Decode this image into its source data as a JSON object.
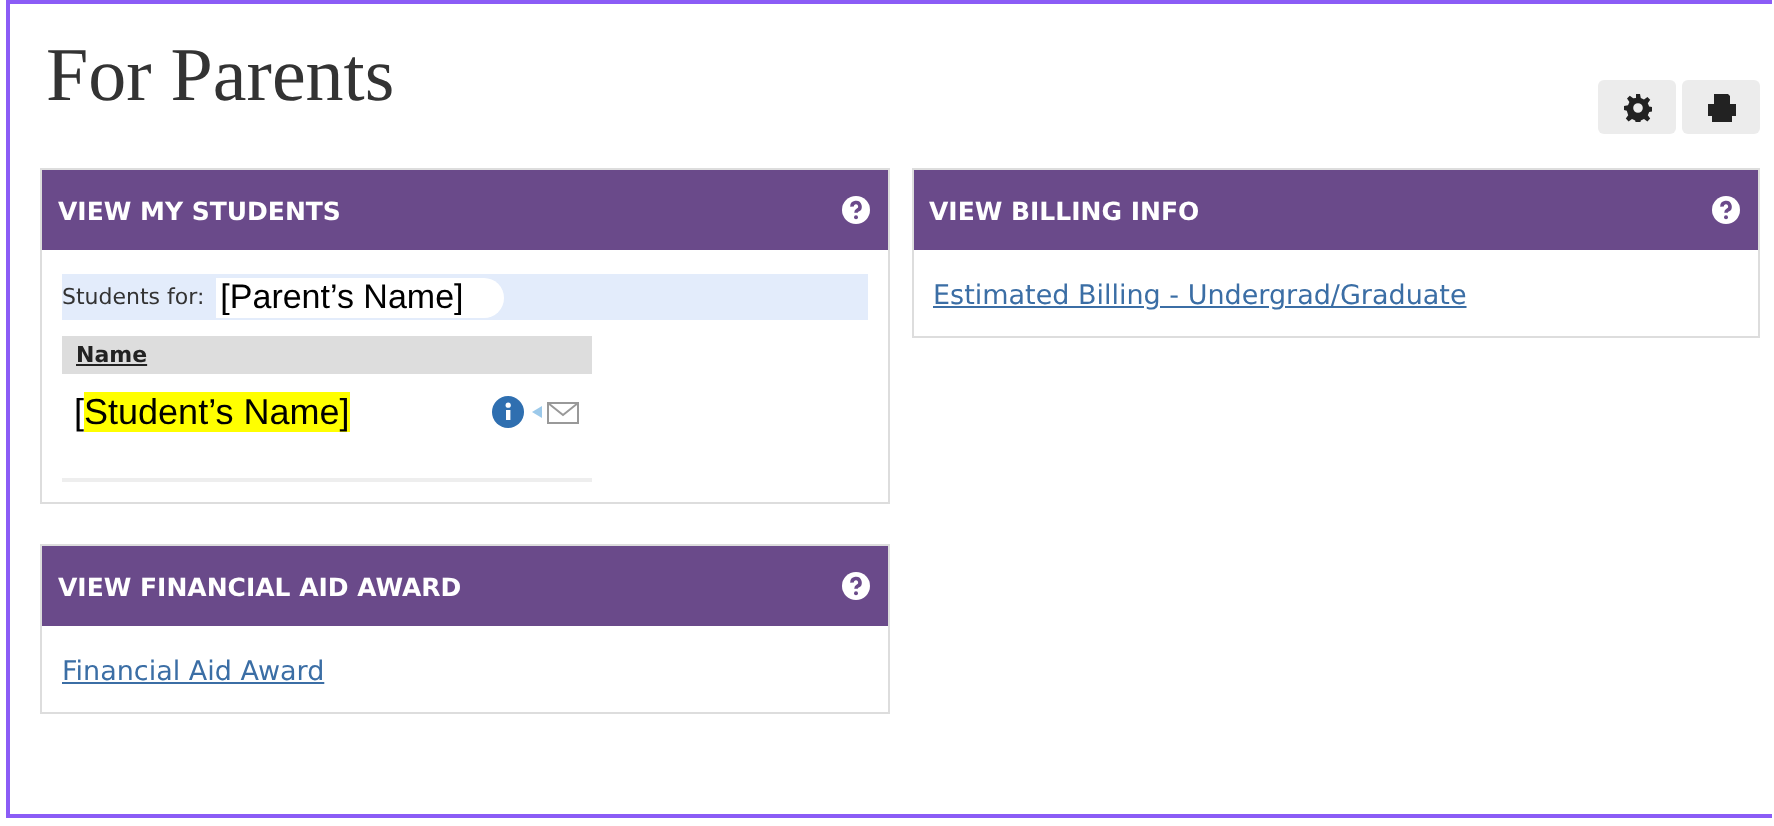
{
  "page": {
    "title": "For Parents"
  },
  "toolbar": [
    {
      "kind": "settings"
    },
    {
      "kind": "print"
    }
  ],
  "left_panels": [
    {
      "kind": "students",
      "title": "VIEW MY STUDENTS",
      "students_for_label": "Students for:",
      "parent_name": "[Parent’s Name]",
      "column": "Name",
      "students": [
        {
          "name_plain": "[",
          "name_highlighted": "Student’s Name]"
        }
      ]
    },
    {
      "kind": "links",
      "title": "VIEW FINANCIAL AID AWARD",
      "links": [
        "Financial Aid Award"
      ]
    }
  ],
  "right_panels": [
    {
      "kind": "links",
      "title": "VIEW BILLING INFO",
      "links": [
        "Estimated Billing - Undergrad/Graduate"
      ]
    }
  ]
}
